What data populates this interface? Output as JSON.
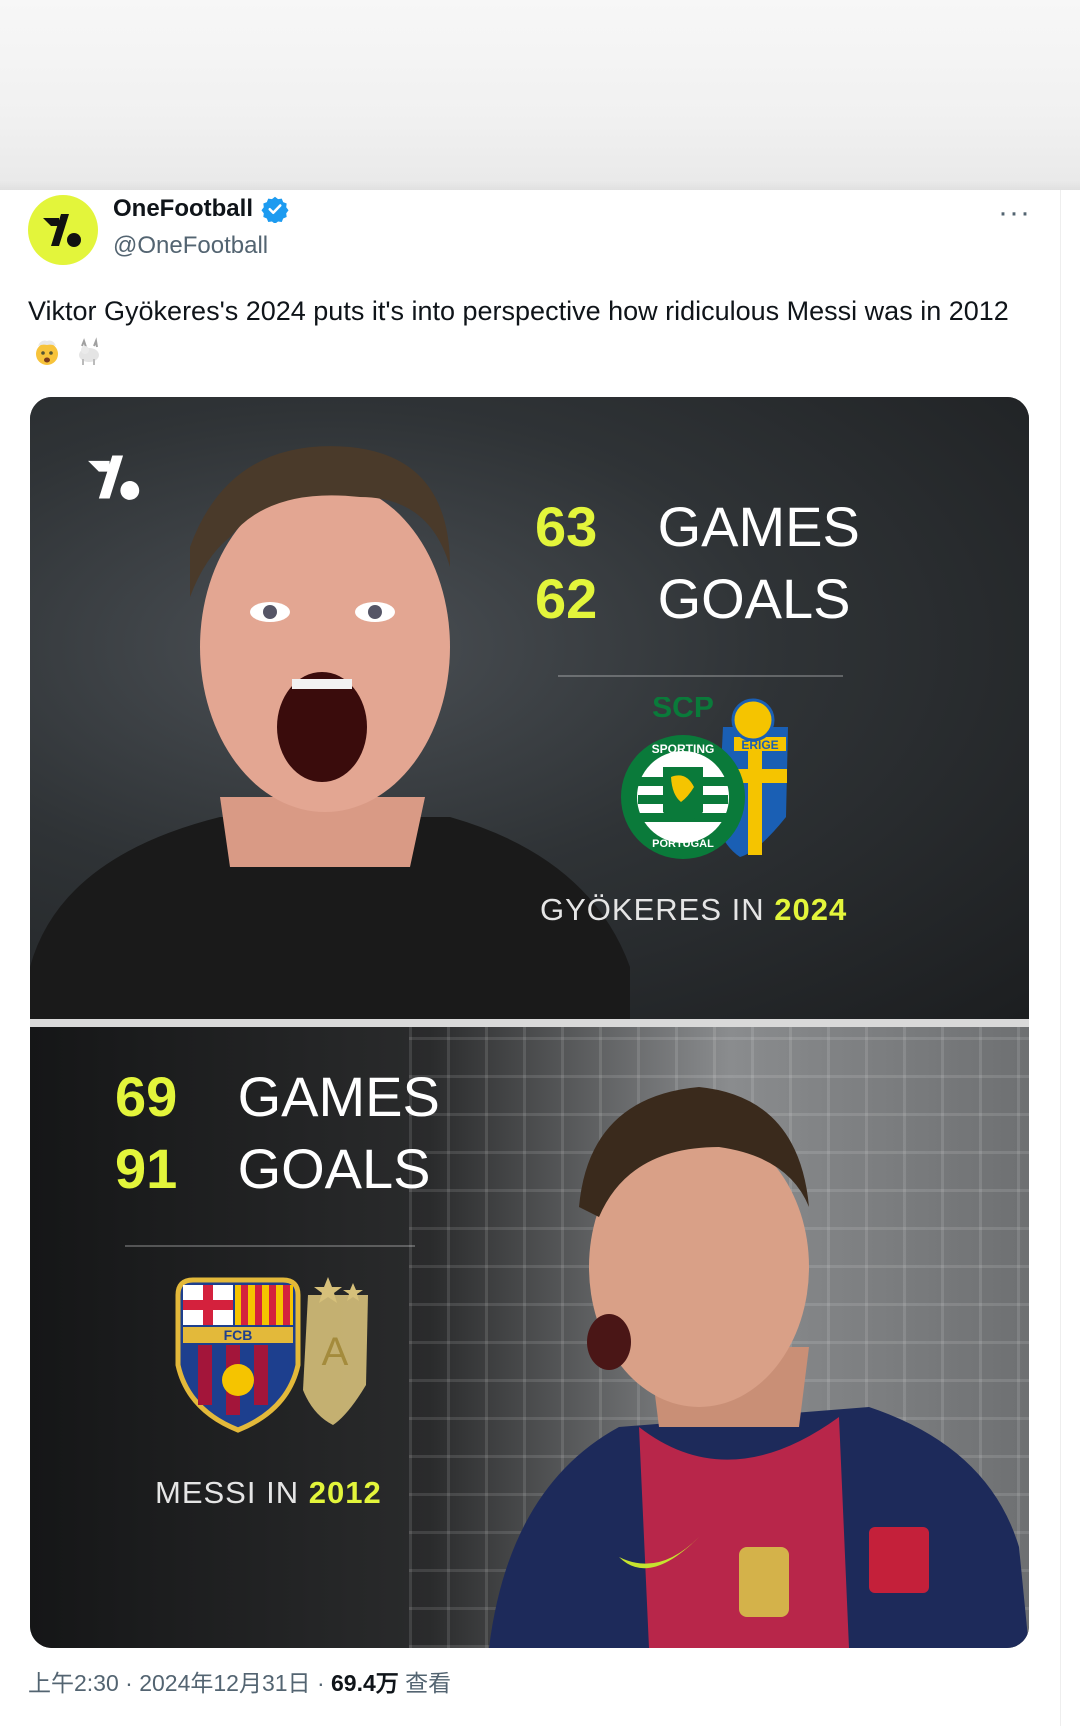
{
  "author": {
    "display_name": "OneFootball",
    "handle": "@OneFootball",
    "more_label": "···"
  },
  "tweet": {
    "text": "Viktor Gyökeres's 2024 puts it's into perspective how ridiculous Messi was in 2012",
    "emojis": [
      "exploding-head-emoji",
      "goat-emoji"
    ]
  },
  "media": {
    "top": {
      "games_num": "63",
      "games_label": "GAMES",
      "goals_num": "62",
      "goals_label": "GOALS",
      "caption_prefix": "GYÖKERES IN",
      "caption_year": "2024",
      "crest_text": "SCP",
      "crest_ring_top": "SPORTING",
      "crest_ring_bottom": "PORTUGAL",
      "crest2_text": "ERIGE"
    },
    "bottom": {
      "games_num": "69",
      "games_label": "GAMES",
      "goals_num": "91",
      "goals_label": "GOALS",
      "caption_prefix": "MESSI IN",
      "caption_year": "2012",
      "crest_text": "FCB",
      "crest2_text": "A"
    }
  },
  "meta": {
    "time": "上午2:30",
    "date": "2024年12月31日",
    "views_count": "69.4万",
    "views_label": "查看"
  },
  "colors": {
    "accent": "#e3f53b",
    "verified": "#1d9bf0",
    "secondary_text": "#536471"
  }
}
